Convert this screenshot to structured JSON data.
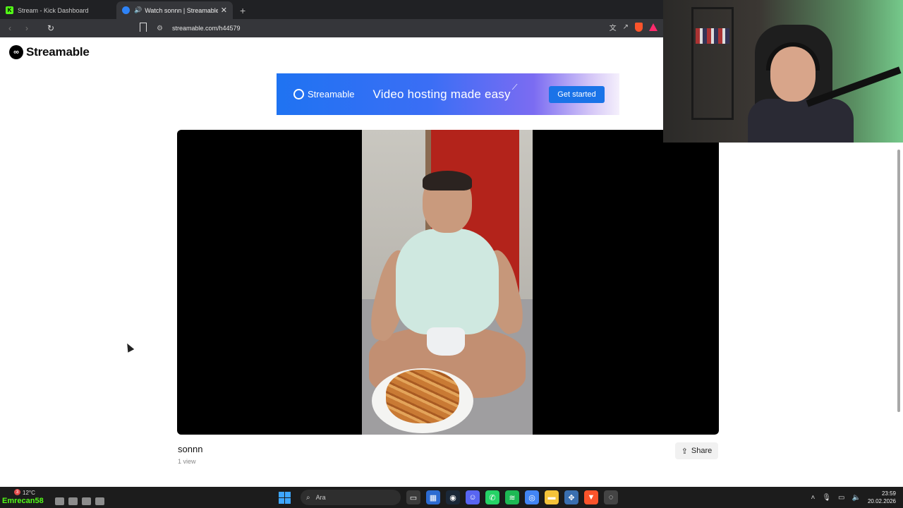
{
  "browser": {
    "tabs": [
      {
        "label": "Stream - Kick Dashboard",
        "active": false
      },
      {
        "label": "Watch sonnn | Streamable",
        "active": true
      }
    ],
    "url": "streamable.com/h44579"
  },
  "page": {
    "logo_text": "Streamable",
    "ad_banner": {
      "brand": "Streamable",
      "tagline": "Video hosting made easy",
      "cta_label": "Get started"
    },
    "video": {
      "title": "sonnn",
      "views": "1 view"
    },
    "share_label": "Share"
  },
  "taskbar": {
    "weather": "12°C",
    "notification_count": "3",
    "kick_user": "Emrecan58",
    "search_placeholder": "Ara",
    "time": "23:59",
    "date": "20.02.2026"
  },
  "colors": {
    "accent": "#1a73e8",
    "kick_green": "#53fc18"
  }
}
